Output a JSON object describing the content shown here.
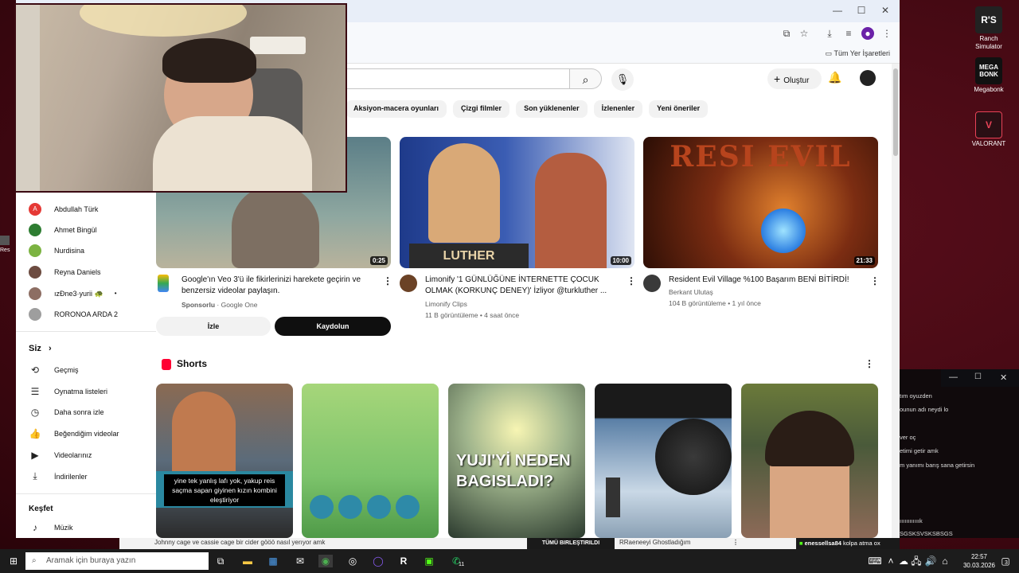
{
  "desktop": {
    "icons": [
      {
        "label_line1": "Ranch",
        "label_line2": "Simulator",
        "glyph": "R'S",
        "color": "#222222"
      },
      {
        "label_line1": "Megabonk",
        "label_line2": "",
        "glyph": "MEGA BONK",
        "color": "#111111"
      },
      {
        "label_line1": "VALORANT",
        "label_line2": "",
        "glyph": "V",
        "color": "#e84357"
      }
    ],
    "partial_icon_label": "Res"
  },
  "browser": {
    "window_controls": {
      "minimize": "—",
      "maximize": "☐",
      "close": "✕"
    },
    "bookmarks_all": "Tüm Yer İşaretleri"
  },
  "youtube": {
    "create_label": "Oluştur",
    "chips": [
      "Aksiyon-macera oyunları",
      "Çizgi filmler",
      "Son yüklenenler",
      "İzlenenler",
      "Yeni öneriler"
    ],
    "subscriptions": [
      {
        "name": "Abdullah Türk",
        "avatar_letter": "A",
        "color": "#e53935"
      },
      {
        "name": "Ahmet Bingül",
        "avatar_letter": "",
        "color": "#2e7d32"
      },
      {
        "name": "Nurdisina",
        "avatar_letter": "",
        "color": "#7cb342"
      },
      {
        "name": "Reyna Daniels",
        "avatar_letter": "",
        "color": "#6d4c41"
      },
      {
        "name": "ızƉne3·yurii 🐢",
        "avatar_letter": "",
        "color": "#8d6e63"
      },
      {
        "name": "RORONOA ARDA 2",
        "avatar_letter": "",
        "color": "#9e9e9e"
      }
    ],
    "you_section": {
      "title": "Siz",
      "chevron": "›",
      "items": [
        {
          "label": "Geçmiş",
          "icon": "history-icon",
          "glyph": "⟲"
        },
        {
          "label": "Oynatma listeleri",
          "icon": "playlist-icon",
          "glyph": "☰"
        },
        {
          "label": "Daha sonra izle",
          "icon": "clock-icon",
          "glyph": "◷"
        },
        {
          "label": "Beğendiğim videolar",
          "icon": "thumbs-up-icon",
          "glyph": "👍"
        },
        {
          "label": "Videolarınız",
          "icon": "video-icon",
          "glyph": "▶"
        },
        {
          "label": "İndirilenler",
          "icon": "download-icon",
          "glyph": "⤓"
        }
      ]
    },
    "explore_section": {
      "title": "Keşfet",
      "items": [
        {
          "label": "Müzik",
          "icon": "music-icon",
          "glyph": "♪"
        }
      ]
    },
    "ad": {
      "title": "Google'ın Veo 3'ü ile fikirlerinizi harekete geçirin ve benzersiz videolar paylaşın.",
      "sponsor": "Sponsorlu",
      "advertiser": "Google One",
      "duration": "0:25",
      "watch_label": "İzle",
      "signup_label": "Kaydolun"
    },
    "videos": [
      {
        "title": "Limonify '1 GÜNLÜĞÜNE İNTERNETTE ÇOCUK OLMAK (KORKUNÇ DENEY)' İzliyor @turkluther ...",
        "channel": "Limonify Clips",
        "views": "11 B görüntüleme",
        "age": "4 saat önce",
        "duration": "10:00",
        "thumb_text": "LUTHER",
        "thumb_color": "#1e3a8a"
      },
      {
        "title": "Resident Evil Village %100 Başarım BENİ BİTİRDİ!",
        "channel": "Berkant Ulutaş",
        "views": "104 B görüntüleme",
        "age": "1 yıl önce",
        "duration": "21:33",
        "thumb_text": "RESI EVIL",
        "thumb_color": "#7c2d12"
      }
    ],
    "shorts_title": "Shorts",
    "shorts": [
      {
        "caption": "yine tek yanlış lafı yok, yakup reis saçma sapan giyinen kızın kombini eleştiriyor",
        "color": "#5b6b7a"
      },
      {
        "caption": "",
        "color": "#7cc36b"
      },
      {
        "caption": "YUJI'Yİ NEDEN BAGISLADI?",
        "color": "#9fb48c"
      },
      {
        "caption": "",
        "color": "#5a7fa6"
      },
      {
        "caption": "",
        "color": "#4a5a3a"
      }
    ]
  },
  "chat": {
    "lines": [
      "tım oyuzden",
      "ounun adı neydi lo",
      "ver oç",
      "etimi getir amk",
      "m yanımı barış sana getirsin",
      "ıııııııııııık",
      "SGSKSVSKSBSGS"
    ]
  },
  "bottom_strip": {
    "left_text": "Johnny cage ve cassie cage bir cider gööö nasıl yerıyor amk",
    "banner": "TÜMÜ BIRLEŞTIRILDI",
    "banner_title": "RRaeneeyi Ghostladığım",
    "user": "enessellsa84",
    "msg": "kolpa atma ox"
  },
  "taskbar": {
    "search_placeholder": "Aramak için buraya yazın",
    "time": "22:57",
    "date": "30.03.2026",
    "notification_count": "3",
    "badge": "11"
  }
}
